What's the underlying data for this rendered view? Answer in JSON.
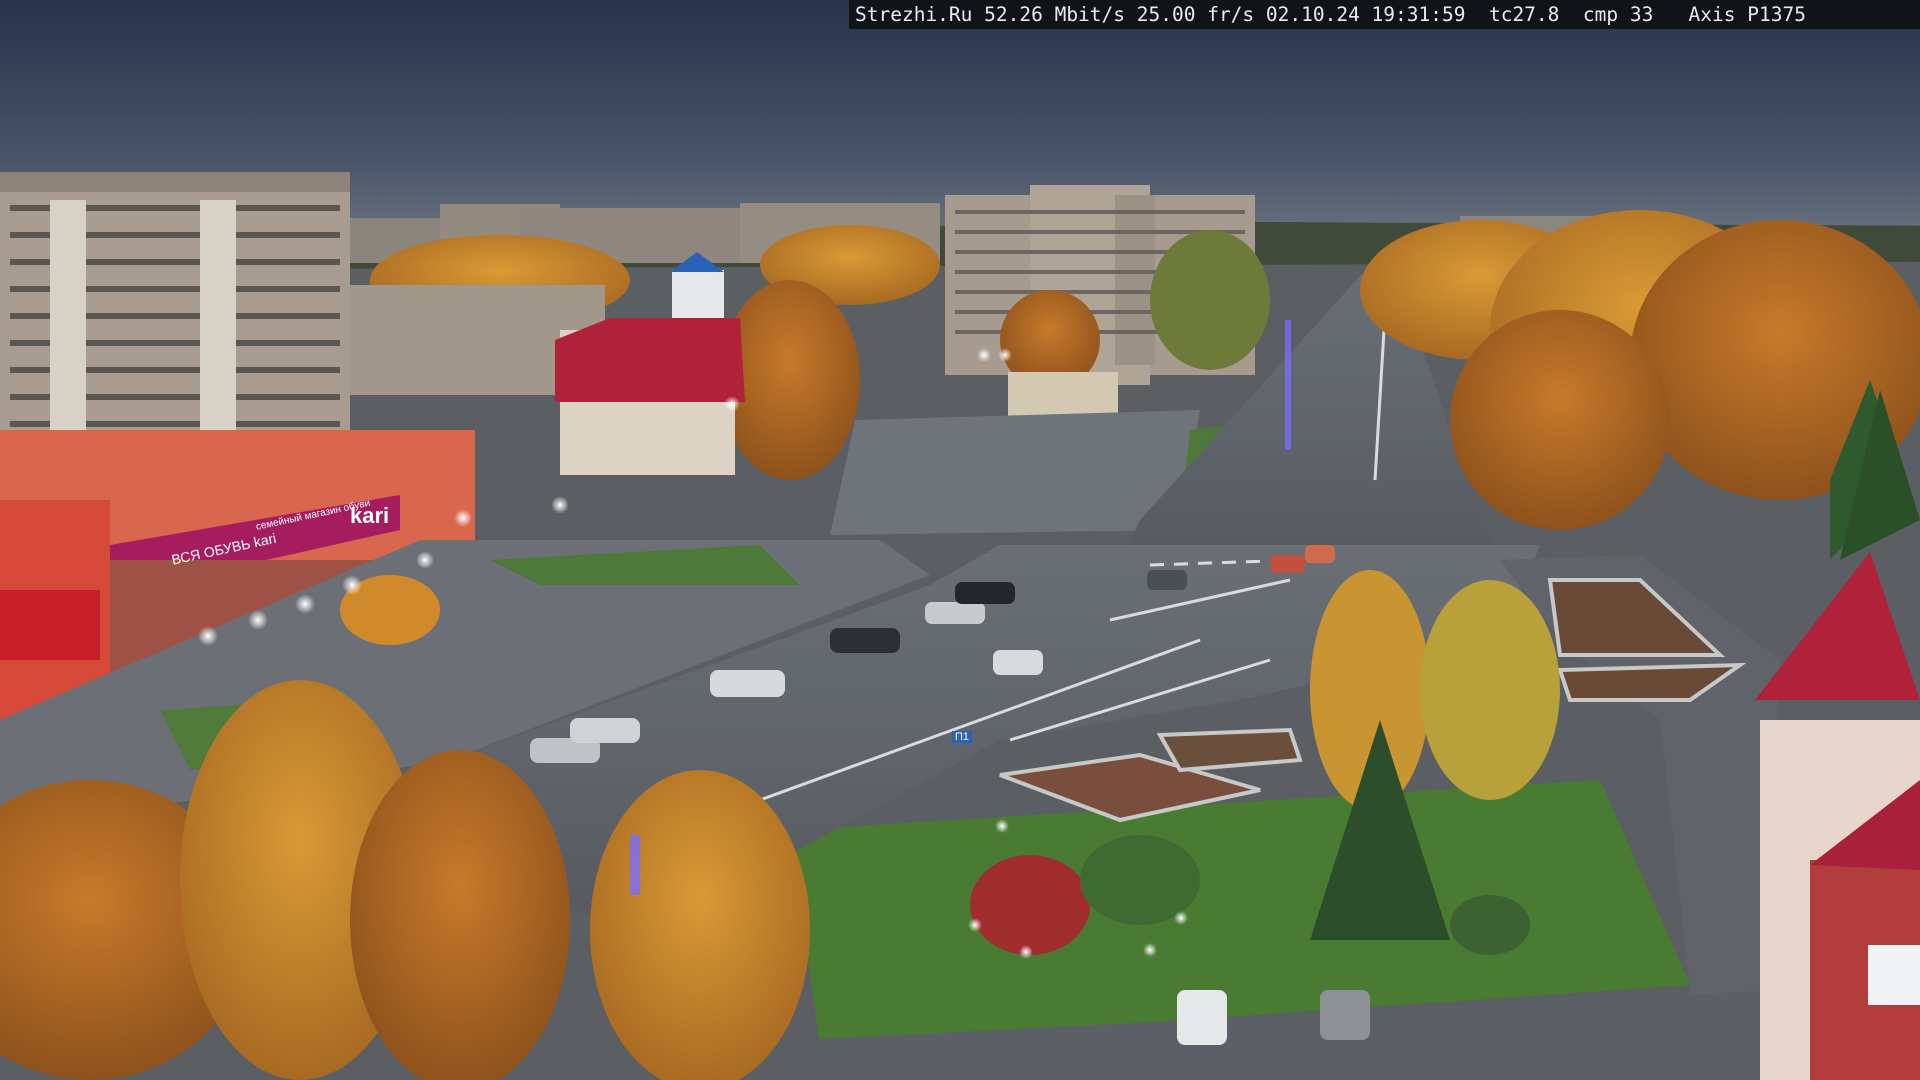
{
  "overlay": {
    "text": "Strezhi.Ru 52.26 Mbit/s 25.00 fr/s 02.10.24 19:31:59  tc27.8  cmp 33   Axis P1375"
  },
  "signs": {
    "kari_logo": "kari",
    "kari_banner": "ВСЯ ОБУВЬ kari",
    "kari_sub": "семейный магазин обуви",
    "shop_left": "",
    "bus_sign": "П1"
  },
  "colors": {
    "sky_top": "#2e3850",
    "sky_horizon": "#5d6877",
    "road": "#5a5f66",
    "kari_magenta": "#a51d5e",
    "autumn_orange": "#c9842a",
    "grass": "#4d7a3a",
    "red_roof": "#b0213a"
  }
}
